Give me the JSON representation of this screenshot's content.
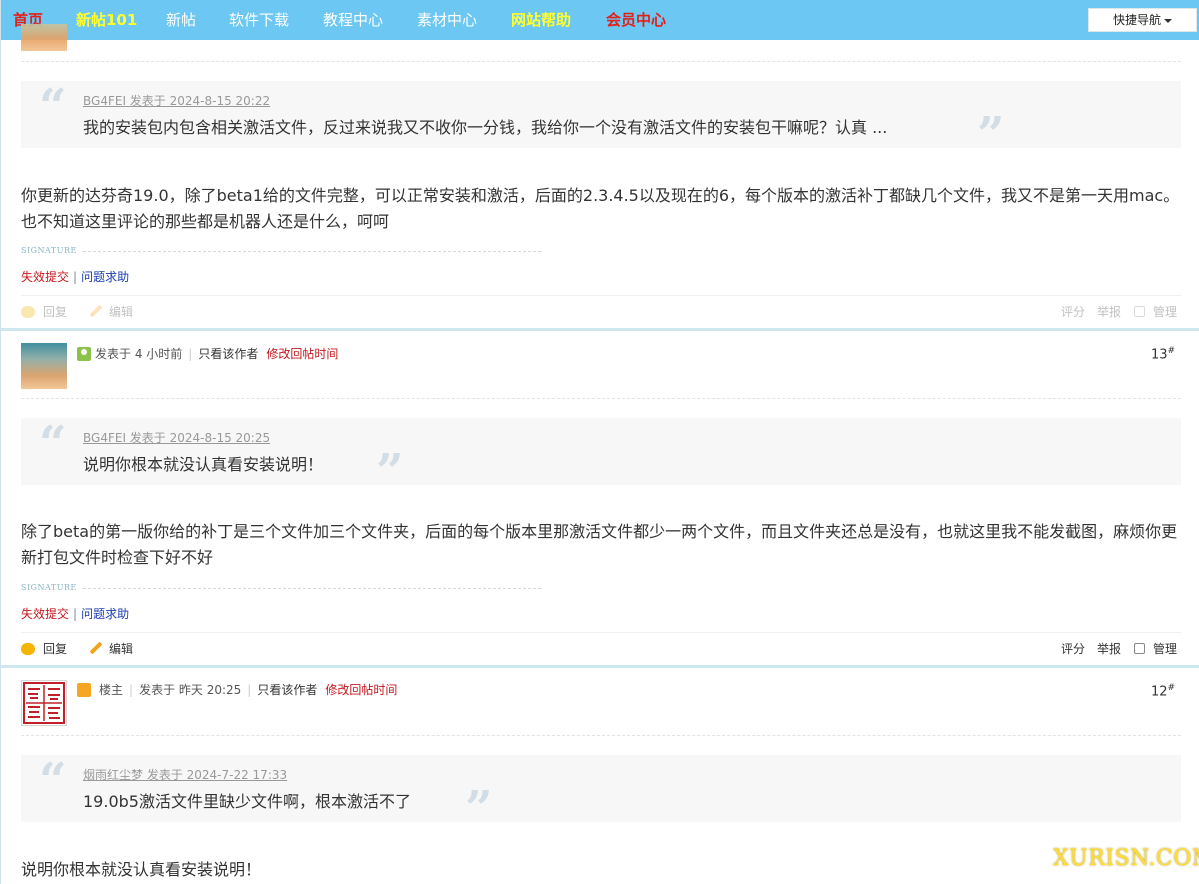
{
  "nav": {
    "home": "首页",
    "new101": "新帖101",
    "new": "新帖",
    "software": "软件下载",
    "tutorials": "教程中心",
    "materials": "素材中心",
    "help": "网站帮助",
    "vip": "会员中心",
    "quick_nav": "快捷导航"
  },
  "bleed_post_info": "4 小时前   |  只看该作者   修改回帖时间",
  "posts": [
    {
      "quote": {
        "author": "BG4FEI 发表于 2024-8-15 20:22",
        "text": "我的安装包内包含相关激活文件，反过来说我又不收你一分钱，我给你一个没有激活文件的安装包干嘛呢？认真 ..."
      },
      "body": "你更新的达芬奇19.0，除了beta1给的文件完整，可以正常安装和激活，后面的2.3.4.5以及现在的6，每个版本的激活补丁都缺几个文件，我又不是第一天用mac。也不知道这里评论的那些都是机器人还是什么，呵呵",
      "signature_label": "SIGNATURE",
      "sig_link_1": "失效提交",
      "sig_link_2": "问题求助",
      "actions": {
        "reply": "回复",
        "edit": "编辑",
        "rate": "评分",
        "report": "举报",
        "manage": "管理"
      }
    },
    {
      "meta": {
        "posted": "发表于 4 小时前",
        "only_author": "只看该作者",
        "edit_time": "修改回帖时间"
      },
      "floor": "13",
      "quote": {
        "author": "BG4FEI 发表于 2024-8-15 20:25",
        "text": "说明你根本就没认真看安装说明！"
      },
      "body": "除了beta的第一版你给的补丁是三个文件加三个文件夹，后面的每个版本里那激活文件都少一两个文件，而且文件夹还总是没有，也就这里我不能发截图，麻烦你更新打包文件时检查下好不好",
      "signature_label": "SIGNATURE",
      "sig_link_1": "失效提交",
      "sig_link_2": "问题求助",
      "actions": {
        "reply": "回复",
        "edit": "编辑",
        "rate": "评分",
        "report": "举报",
        "manage": "管理"
      }
    },
    {
      "meta": {
        "host": "楼主",
        "posted": "发表于 昨天 20:25",
        "only_author": "只看该作者",
        "edit_time": "修改回帖时间"
      },
      "floor": "12",
      "quote": {
        "author": "烟雨红尘梦 发表于 2024-7-22 17:33",
        "text": "19.0b5激活文件里缺少文件啊，根本激活不了"
      },
      "body": "说明你根本就没认真看安装说明！"
    }
  ],
  "watermark": "XURISN.COM"
}
